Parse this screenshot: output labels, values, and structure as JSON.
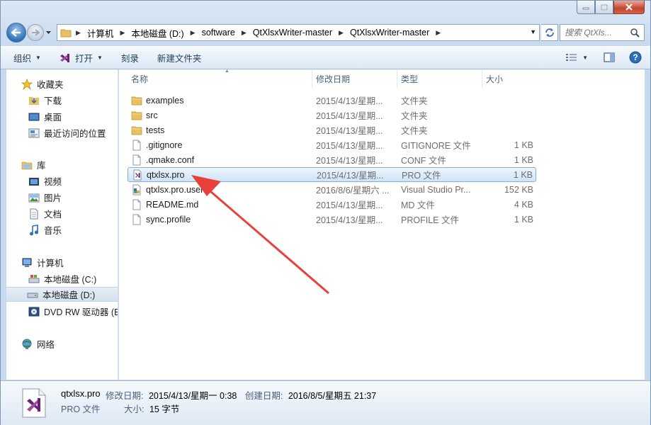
{
  "window": {
    "minimize_icon": "minimize-icon",
    "maximize_icon": "maximize-icon",
    "close_icon": "close-icon"
  },
  "address_bar": {
    "crumbs": [
      "计算机",
      "本地磁盘 (D:)",
      "software",
      "QtXlsxWriter-master",
      "QtXlsxWriter-master"
    ],
    "search_placeholder": "搜索 QtXls..."
  },
  "toolbar": {
    "organize": "组织",
    "open": "打开",
    "burn": "刻录",
    "new_folder": "新建文件夹"
  },
  "nav": {
    "favorites": "收藏夹",
    "downloads": "下载",
    "desktop": "桌面",
    "recent": "最近访问的位置",
    "libraries": "库",
    "videos": "视频",
    "pictures": "图片",
    "documents": "文档",
    "music": "音乐",
    "computer": "计算机",
    "drive_c": "本地磁盘 (C:)",
    "drive_d": "本地磁盘 (D:)",
    "dvd": "DVD RW 驱动器 (E",
    "network": "网络"
  },
  "columns": {
    "name": "名称",
    "date": "修改日期",
    "type": "类型",
    "size": "大小"
  },
  "files": [
    {
      "name": "examples",
      "date": "2015/4/13/星期...",
      "type": "文件夹",
      "size": "",
      "icon": "folder-icon"
    },
    {
      "name": "src",
      "date": "2015/4/13/星期...",
      "type": "文件夹",
      "size": "",
      "icon": "folder-icon"
    },
    {
      "name": "tests",
      "date": "2015/4/13/星期...",
      "type": "文件夹",
      "size": "",
      "icon": "folder-icon"
    },
    {
      "name": ".gitignore",
      "date": "2015/4/13/星期...",
      "type": "GITIGNORE 文件",
      "size": "1 KB",
      "icon": "file-icon"
    },
    {
      "name": ".qmake.conf",
      "date": "2015/4/13/星期...",
      "type": "CONF 文件",
      "size": "1 KB",
      "icon": "file-icon"
    },
    {
      "name": "qtxlsx.pro",
      "date": "2015/4/13/星期...",
      "type": "PRO 文件",
      "size": "1 KB",
      "icon": "visual-studio-file-icon"
    },
    {
      "name": "qtxlsx.pro.user",
      "date": "2016/8/6/星期六 ...",
      "type": "Visual Studio Pr...",
      "size": "152 KB",
      "icon": "user-file-icon"
    },
    {
      "name": "README.md",
      "date": "2015/4/13/星期...",
      "type": "MD 文件",
      "size": "4 KB",
      "icon": "file-icon"
    },
    {
      "name": "sync.profile",
      "date": "2015/4/13/星期...",
      "type": "PROFILE 文件",
      "size": "1 KB",
      "icon": "file-icon"
    }
  ],
  "selected_file_index": 5,
  "annotation": {
    "color": "#e8403a",
    "icon": "red-arrow-annotation"
  },
  "details": {
    "name": "qtxlsx.pro",
    "type": "PRO 文件",
    "modified_label": "修改日期:",
    "modified_value": "2015/4/13/星期一 0:38",
    "created_label": "创建日期:",
    "created_value": "2016/8/5/星期五 21:37",
    "size_label": "大小:",
    "size_value": "15 字节"
  }
}
